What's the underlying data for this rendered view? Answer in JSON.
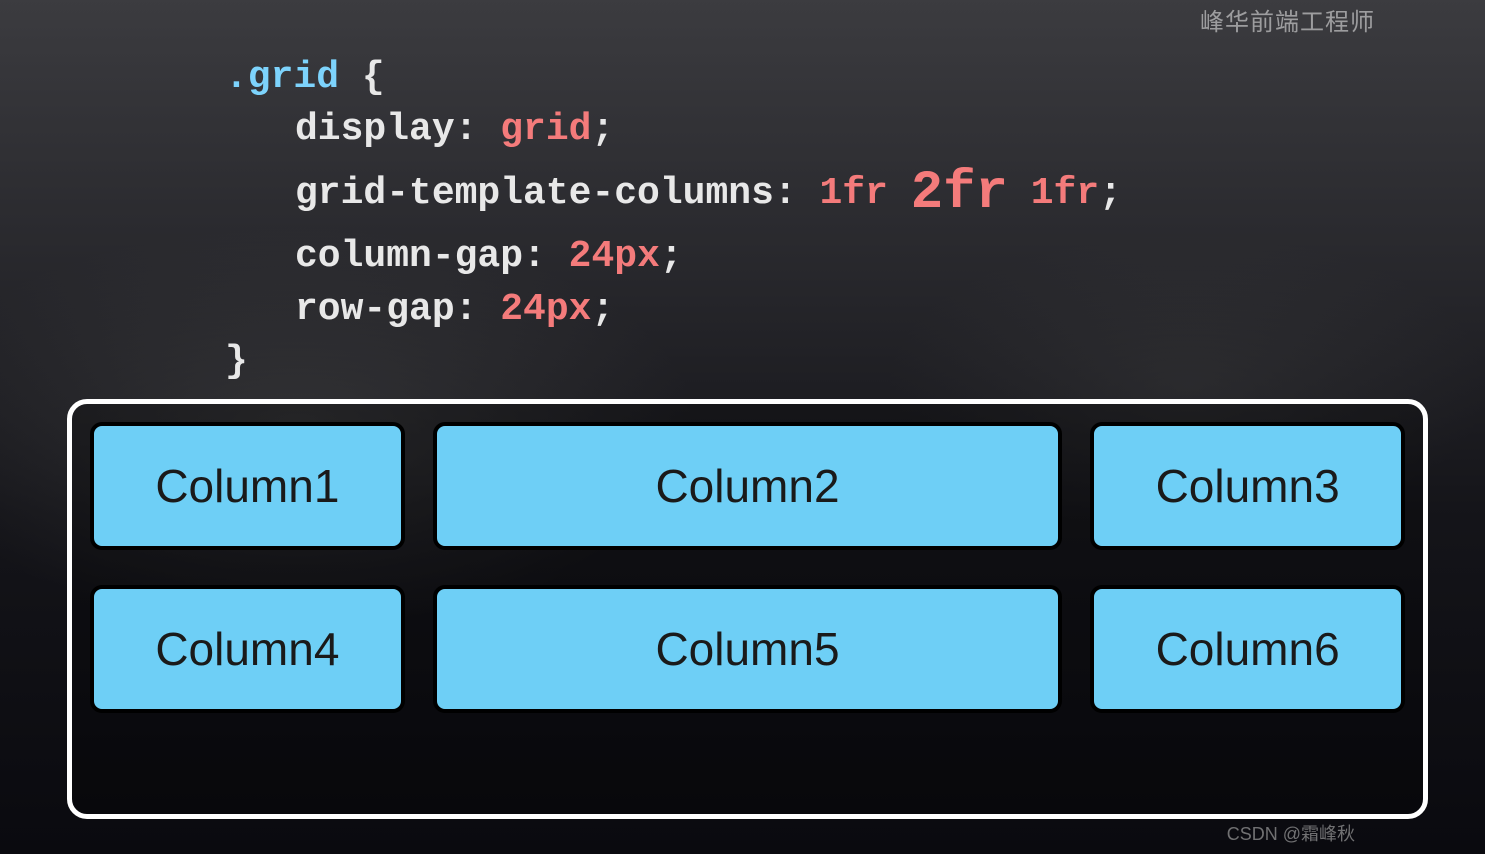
{
  "watermarks": {
    "top": "峰华前端工程师",
    "bottom": "CSDN @霜峰秋"
  },
  "code": {
    "selector": ".grid",
    "open_brace": " {",
    "close_brace": "}",
    "lines": [
      {
        "prop": "display",
        "value": "grid",
        "sep": ": ",
        "term": ";"
      },
      {
        "prop": "grid-template-columns",
        "value_parts": [
          "1fr ",
          "2fr",
          " 1fr"
        ],
        "emph_index": 1,
        "sep": ": ",
        "term": ";"
      },
      {
        "prop": "column-gap",
        "value": "24px",
        "sep": ": ",
        "term": ";"
      },
      {
        "prop": "row-gap",
        "value": "24px",
        "sep": ": ",
        "term": ";"
      }
    ]
  },
  "grid": {
    "cells": [
      {
        "label": "Column1"
      },
      {
        "label": "Column2"
      },
      {
        "label": "Column3"
      },
      {
        "label": "Column4"
      },
      {
        "label": "Column5"
      },
      {
        "label": "Column6"
      }
    ]
  }
}
